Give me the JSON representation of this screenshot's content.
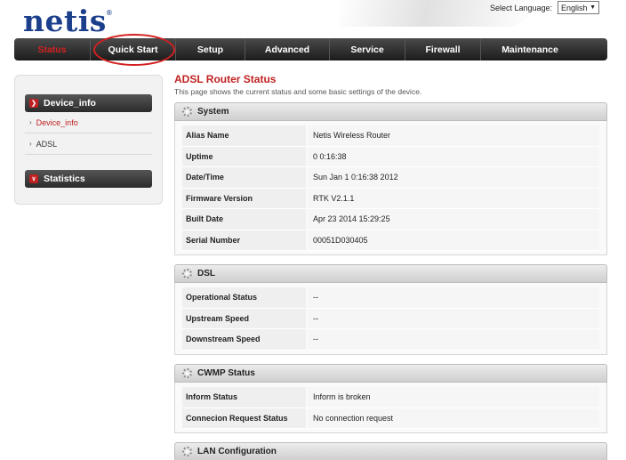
{
  "brand": {
    "logo_text": "netis",
    "logo_mark": "®"
  },
  "language": {
    "label": "Select Language:",
    "selected": "English"
  },
  "nav": [
    {
      "label": "Status",
      "active": true
    },
    {
      "label": "Quick Start",
      "active": false
    },
    {
      "label": "Setup",
      "active": false
    },
    {
      "label": "Advanced",
      "active": false
    },
    {
      "label": "Service",
      "active": false
    },
    {
      "label": "Firewall",
      "active": false
    },
    {
      "label": "Maintenance",
      "active": false
    }
  ],
  "sidebar": {
    "groups": [
      {
        "label": "Device_info",
        "icon": "chevron-right-icon",
        "links": [
          {
            "label": "Device_info",
            "current": true
          },
          {
            "label": "ADSL",
            "current": false
          }
        ]
      },
      {
        "label": "Statistics",
        "icon": "chevron-down-icon",
        "links": []
      }
    ]
  },
  "page": {
    "title": "ADSL Router Status",
    "description": "This page shows the current status and some basic settings of the device."
  },
  "sections": [
    {
      "title": "System",
      "rows": [
        {
          "label": "Alias Name",
          "value": "Netis Wireless Router"
        },
        {
          "label": "Uptime",
          "value": "0 0:16:38"
        },
        {
          "label": "Date/Time",
          "value": "Sun Jan 1 0:16:38 2012"
        },
        {
          "label": "Firmware Version",
          "value": "RTK V2.1.1"
        },
        {
          "label": "Built Date",
          "value": "Apr 23 2014 15:29:25"
        },
        {
          "label": "Serial Number",
          "value": "00051D030405"
        }
      ]
    },
    {
      "title": "DSL",
      "rows": [
        {
          "label": "Operational Status",
          "value": "--"
        },
        {
          "label": "Upstream Speed",
          "value": "--"
        },
        {
          "label": "Downstream Speed",
          "value": "--"
        }
      ]
    },
    {
      "title": "CWMP Status",
      "rows": [
        {
          "label": "Inform Status",
          "value": "Inform is broken"
        },
        {
          "label": "Connecion Request Status",
          "value": "No connection request"
        }
      ]
    },
    {
      "title": "LAN Configuration",
      "rows": []
    }
  ],
  "colors": {
    "brand_blue": "#1c3f8c",
    "accent_red": "#d42020",
    "nav_dark": "#2b2b2b"
  }
}
